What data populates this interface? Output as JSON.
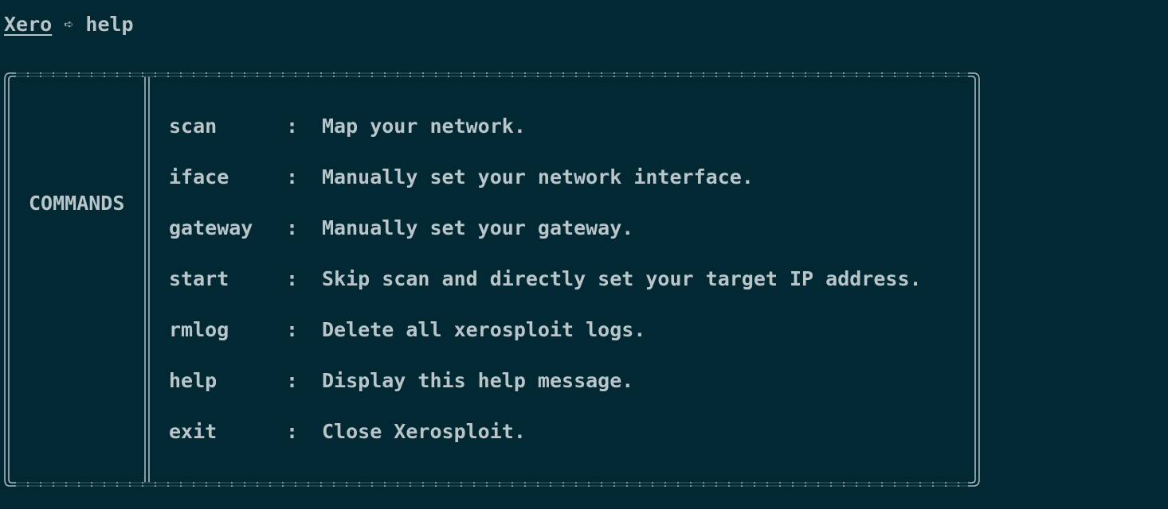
{
  "prompt": {
    "shell_name": "Xero",
    "arrow": "➪",
    "command": "help"
  },
  "help_table": {
    "header": "COMMANDS",
    "separator": ":",
    "rows": [
      {
        "command": "scan",
        "description": "Map your network."
      },
      {
        "command": "iface",
        "description": "Manually set your network interface."
      },
      {
        "command": "gateway",
        "description": "Manually set your gateway."
      },
      {
        "command": "start",
        "description": "Skip scan and directly set your target IP address."
      },
      {
        "command": "rmlog",
        "description": "Delete all xerosploit logs."
      },
      {
        "command": "help",
        "description": "Display this help message."
      },
      {
        "command": "exit",
        "description": "Close Xerosploit."
      }
    ]
  },
  "colors": {
    "background": "#022834",
    "text": "#b8c5c9",
    "frame": "#a9b8bd"
  }
}
